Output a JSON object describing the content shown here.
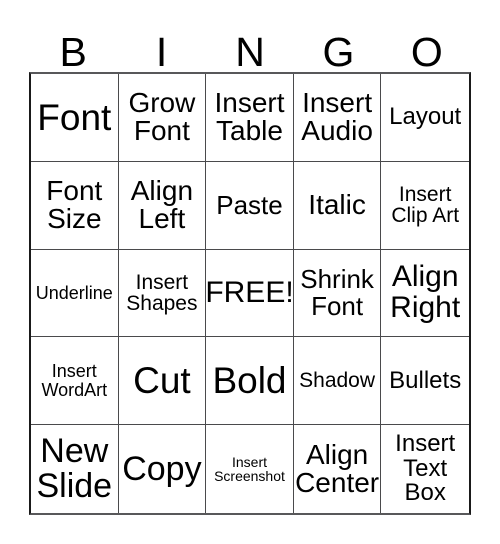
{
  "card": {
    "title_letters": [
      "B",
      "I",
      "N",
      "G",
      "O"
    ],
    "free_space_label": "FREE!",
    "colors": {
      "background": "#ffffff",
      "text": "#000000",
      "grid_line": "#4a4a4c",
      "grid_outer": "#1a1a1a"
    },
    "rows": [
      [
        {
          "label": "Font",
          "size": "fs-xxl"
        },
        {
          "label": "Grow\nFont",
          "size": "fs-ml"
        },
        {
          "label": "Insert\nTable",
          "size": "fs-ml"
        },
        {
          "label": "Insert\nAudio",
          "size": "fs-ml"
        },
        {
          "label": "Layout",
          "size": "fs-sm"
        }
      ],
      [
        {
          "label": "Font\nSize",
          "size": "fs-ml"
        },
        {
          "label": "Align\nLeft",
          "size": "fs-ml"
        },
        {
          "label": "Paste",
          "size": "fs-m"
        },
        {
          "label": "Italic",
          "size": "fs-ml"
        },
        {
          "label": "Insert\nClip Art",
          "size": "fs-s"
        }
      ],
      [
        {
          "label": "Underline",
          "size": "fs-xs"
        },
        {
          "label": "Insert\nShapes",
          "size": "fs-s"
        },
        {
          "label": "FREE!",
          "size": "fs-l"
        },
        {
          "label": "Shrink\nFont",
          "size": "fs-m"
        },
        {
          "label": "Align\nRight",
          "size": "fs-l"
        }
      ],
      [
        {
          "label": "Insert\nWordArt",
          "size": "fs-xs"
        },
        {
          "label": "Cut",
          "size": "fs-xxl"
        },
        {
          "label": "Bold",
          "size": "fs-xxl"
        },
        {
          "label": "Shadow",
          "size": "fs-s"
        },
        {
          "label": "Bullets",
          "size": "fs-sm"
        }
      ],
      [
        {
          "label": "New\nSlide",
          "size": "fs-xl"
        },
        {
          "label": "Copy",
          "size": "fs-xl"
        },
        {
          "label": "Insert\nScreenshot",
          "size": "fs-xxs"
        },
        {
          "label": "Align\nCenter",
          "size": "fs-ml"
        },
        {
          "label": "Insert\nText\nBox",
          "size": "fs-sm"
        }
      ]
    ]
  }
}
